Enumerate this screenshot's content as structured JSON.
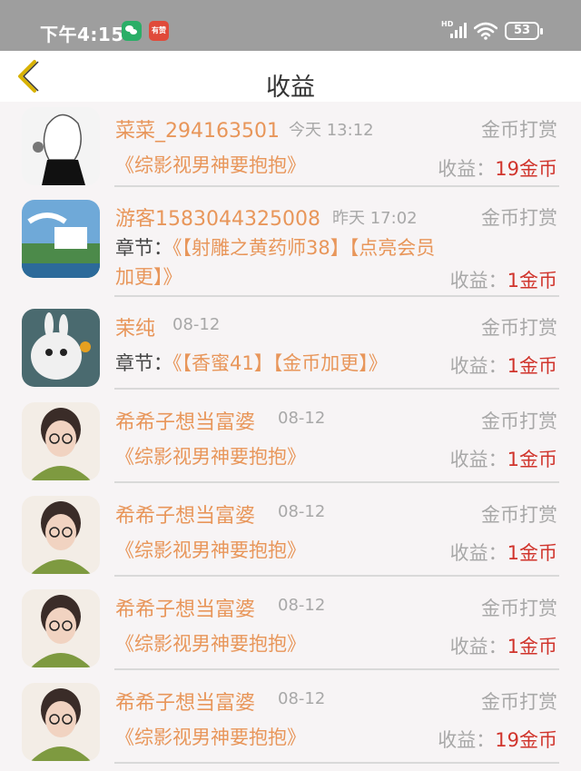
{
  "status_bar": {
    "time": "下午4:15",
    "app_icon_text": "有赞",
    "network": "HD",
    "battery": "53"
  },
  "header": {
    "title": "收益",
    "back_icon": "chevron-left-icon",
    "back_color": "#d8b200"
  },
  "colors": {
    "name": "#e8965a",
    "amount": "#d0342c",
    "muted": "#a8a8a8"
  },
  "earnings_label": "收益：",
  "rows": [
    {
      "name": "菜菜_294163501",
      "time": "今天 13:12",
      "type": "金币打赏",
      "chapter_prefix": "",
      "content": "《综影视男神要抱抱》",
      "amount": "19金币"
    },
    {
      "name": "游客1583044325008",
      "time": "昨天 17:02",
      "type": "金币打赏",
      "chapter_prefix": "章节：",
      "content_line1": "《【射雕之黄药师38】【点亮会员",
      "content_line2": "加更】》",
      "amount": "1金币"
    },
    {
      "name": "茉纯",
      "time": "08-12",
      "type": "金币打赏",
      "chapter_prefix": "章节：",
      "content": "《【香蜜41】【金币加更】》",
      "amount": "1金币"
    },
    {
      "name": "希希子想当富婆",
      "time": "08-12",
      "type": "金币打赏",
      "chapter_prefix": "",
      "content": "《综影视男神要抱抱》",
      "amount": "1金币"
    },
    {
      "name": "希希子想当富婆",
      "time": "08-12",
      "type": "金币打赏",
      "chapter_prefix": "",
      "content": "《综影视男神要抱抱》",
      "amount": "1金币"
    },
    {
      "name": "希希子想当富婆",
      "time": "08-12",
      "type": "金币打赏",
      "chapter_prefix": "",
      "content": "《综影视男神要抱抱》",
      "amount": "1金币"
    },
    {
      "name": "希希子想当富婆",
      "time": "08-12",
      "type": "金币打赏",
      "chapter_prefix": "",
      "content": "《综影视男神要抱抱》",
      "amount": "19金币"
    }
  ]
}
